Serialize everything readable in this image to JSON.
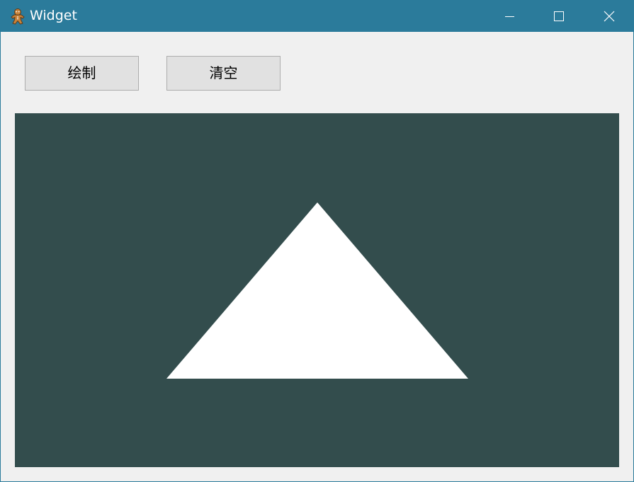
{
  "window": {
    "title": "Widget",
    "app_icon": "gingerbread-man-icon",
    "controls": [
      "minimize-icon",
      "maximize-icon",
      "close-icon"
    ]
  },
  "toolbar": {
    "draw_label": "绘制",
    "clear_label": "清空"
  },
  "canvas": {
    "background": "#334d4d",
    "shape": "triangle",
    "fill": "#ffffff"
  },
  "colors": {
    "titlebar": "#2b7b9b",
    "window_bg": "#f0f0f0",
    "button_bg": "#e1e1e1",
    "button_border": "#adadad"
  }
}
